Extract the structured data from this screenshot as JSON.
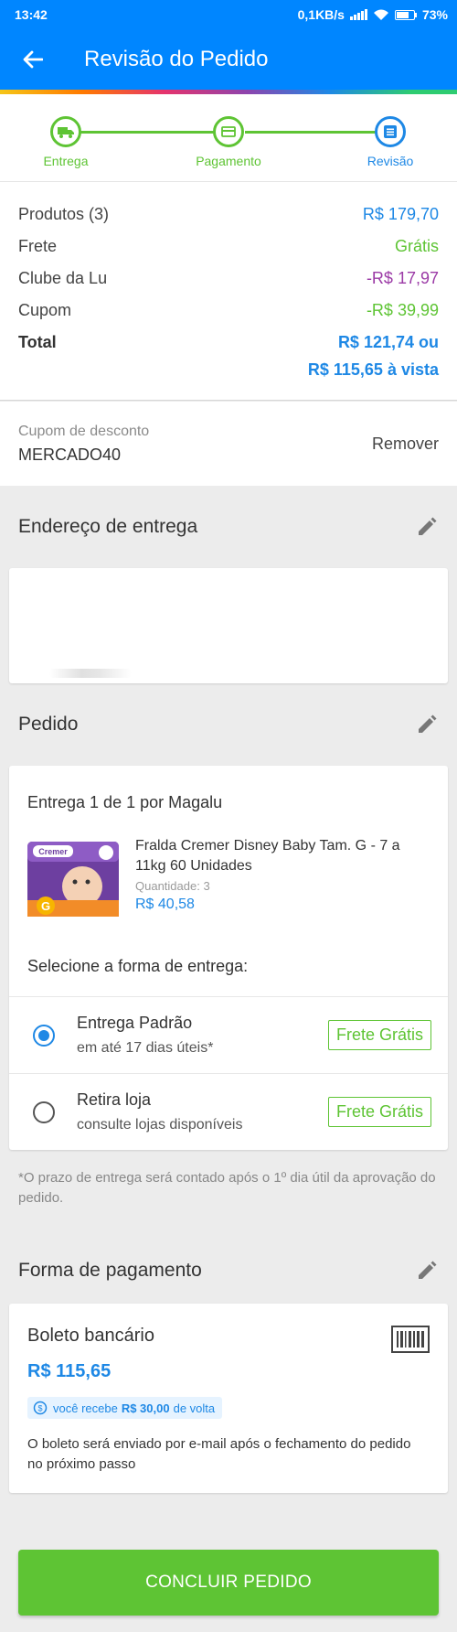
{
  "status_bar": {
    "time": "13:42",
    "net_speed": "0,1KB/s",
    "battery": "73%"
  },
  "header": {
    "title": "Revisão do Pedido"
  },
  "steps": [
    {
      "label": "Entrega",
      "icon": "truck-icon"
    },
    {
      "label": "Pagamento",
      "icon": "card-icon"
    },
    {
      "label": "Revisão",
      "icon": "list-icon"
    }
  ],
  "summary": {
    "products_label": "Produtos (3)",
    "products_value": "R$ 179,70",
    "shipping_label": "Frete",
    "shipping_value": "Grátis",
    "club_label": "Clube da Lu",
    "club_value": "-R$ 17,97",
    "coupon_label": "Cupom",
    "coupon_value": "-R$ 39,99",
    "total_label": "Total",
    "total_value": "R$ 121,74 ou",
    "total_cash": "R$ 115,65 à vista"
  },
  "coupon": {
    "label": "Cupom de desconto",
    "code": "MERCADO40",
    "remove": "Remover"
  },
  "address": {
    "title": "Endereço de entrega"
  },
  "order": {
    "title": "Pedido",
    "delivery_heading": "Entrega 1 de 1 por Magalu",
    "product": {
      "name": "Fralda Cremer Disney Baby Tam. G - 7 a 11kg 60 Unidades",
      "quantity_label": "Quantidade:",
      "quantity": "3",
      "price": "R$ 40,58",
      "image_brand": "Cremer",
      "image_size": "G"
    },
    "select_label": "Selecione a forma de entrega:",
    "options": [
      {
        "title": "Entrega Padrão",
        "subtitle": "em até 17 dias úteis*",
        "badge": "Frete Grátis",
        "selected": true
      },
      {
        "title": "Retira loja",
        "subtitle": "consulte lojas disponíveis",
        "badge": "Frete Grátis",
        "selected": false
      }
    ]
  },
  "note": "*O prazo de entrega será contado após o 1º dia útil da aprovação do pedido.",
  "payment": {
    "title": "Forma de pagamento",
    "method": "Boleto bancário",
    "price": "R$ 115,65",
    "cashback_prefix": "você recebe",
    "cashback_amount": "R$ 30,00",
    "cashback_suffix": "de volta",
    "description": "O boleto será enviado por e-mail após o fechamento do pedido no próximo passo"
  },
  "cta": {
    "label": "CONCLUIR PEDIDO"
  },
  "colors": {
    "primary": "#0086ff",
    "accent_blue": "#1e88e5",
    "green": "#5ec434",
    "purple": "#9b3aa6"
  }
}
